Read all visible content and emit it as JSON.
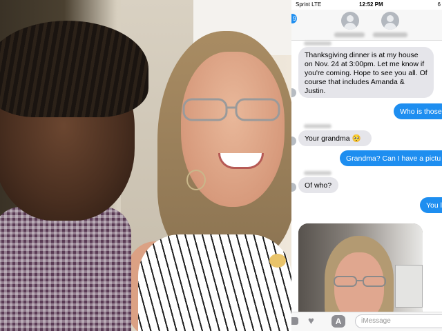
{
  "status_bar": {
    "carrier": "Sprint  LTE",
    "time": "12:52 PM",
    "battery": "6"
  },
  "nav": {
    "back_glyph": "9"
  },
  "messages": [
    {
      "dir": "in",
      "text": "Thanksgiving dinner is at my house on Nov. 24 at 3:00pm.  Let me know if you're coming.  Hope to see you all.  Of course that includes Amanda & Justin."
    },
    {
      "dir": "out",
      "text": "Who is those"
    },
    {
      "dir": "in",
      "text": "Your grandma 🥺"
    },
    {
      "dir": "out",
      "text": "Grandma? Can I have a pictu"
    },
    {
      "dir": "in",
      "text": "Of who?"
    },
    {
      "dir": "out",
      "text": "You l"
    }
  ],
  "input": {
    "placeholder": "iMessage",
    "apps_glyph": "A"
  },
  "icons": {
    "camera": "camera-icon",
    "heart": "digital-touch-icon",
    "apps": "app-store-icon",
    "back": "back-icon"
  },
  "colors": {
    "outgoing_bubble": "#1e8ef0",
    "incoming_bubble": "#e5e5ea"
  }
}
